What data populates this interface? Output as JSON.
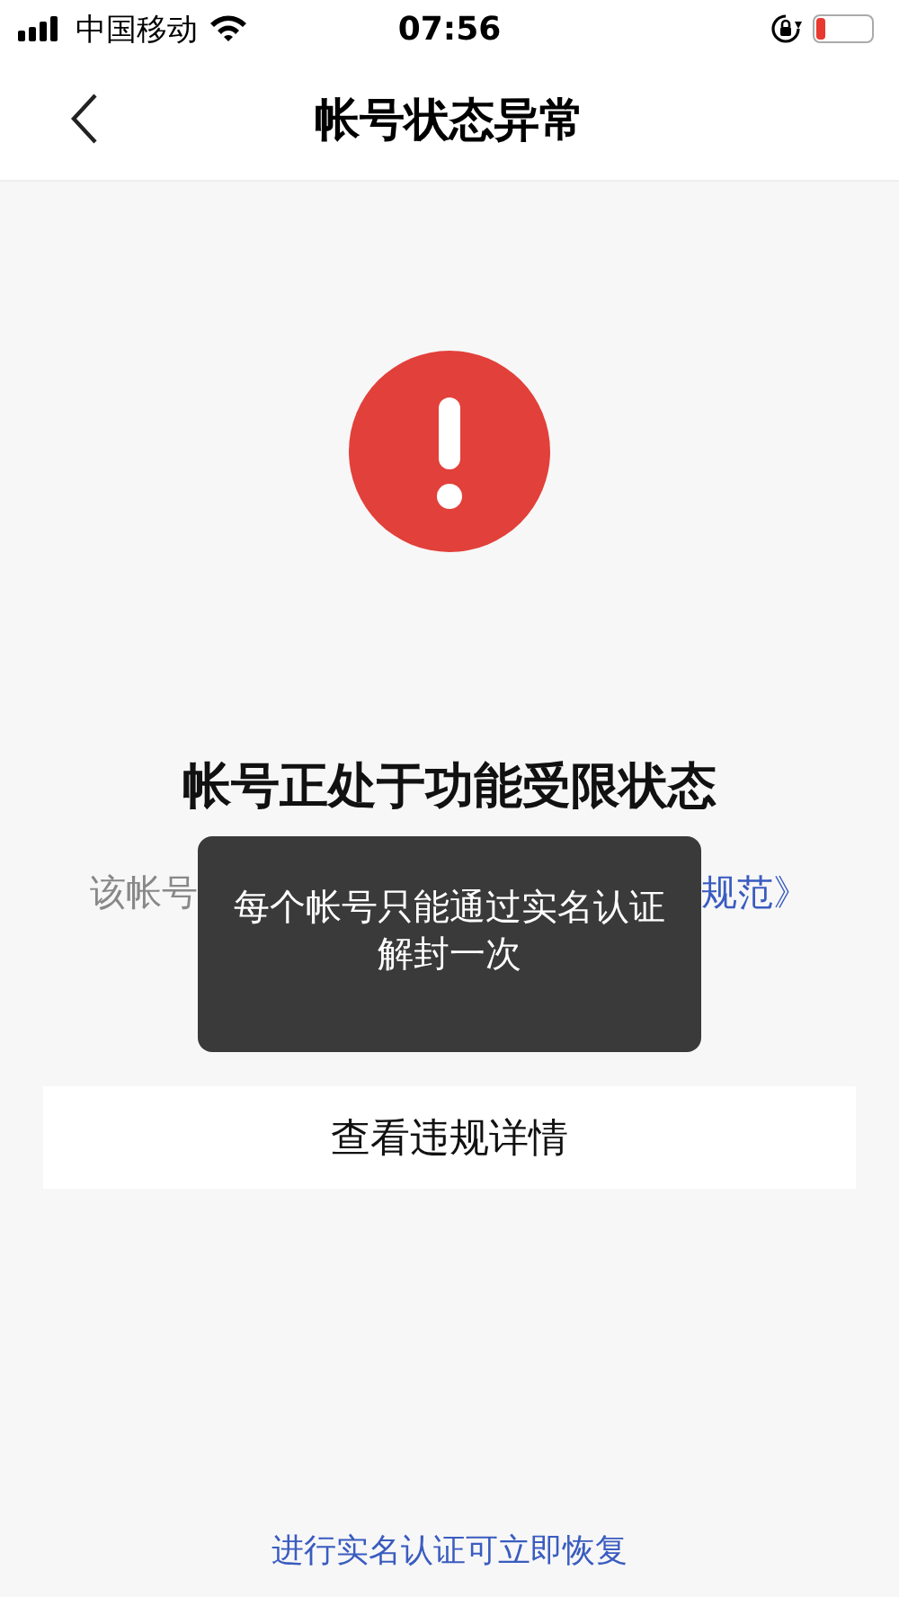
{
  "status_bar": {
    "carrier": "中国移动",
    "time": "07:56"
  },
  "nav": {
    "title": "帐号状态异常"
  },
  "headline": "帐号正处于功能受限状态",
  "notice": {
    "text_before": "该帐号",
    "link": "规范》"
  },
  "button": "查看违规详情",
  "toast": "每个帐号只能通过实名认证解封一次",
  "footer_link": "进行实名认证可立即恢复"
}
